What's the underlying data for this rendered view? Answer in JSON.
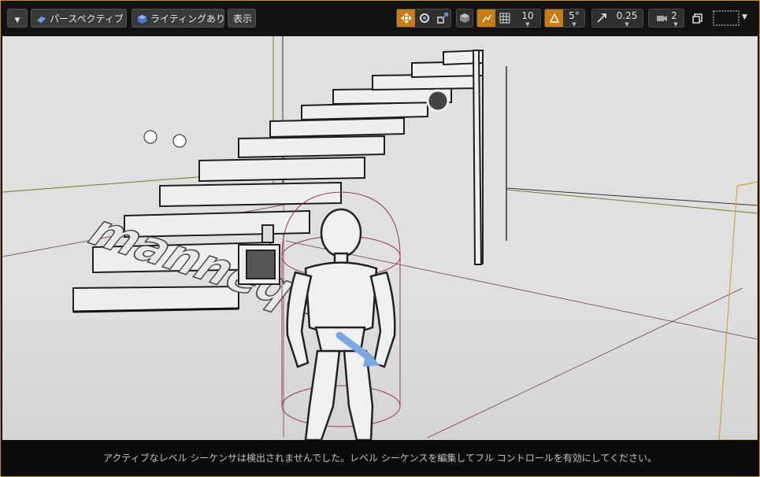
{
  "toolbar": {
    "menu_button": "menu-dropdown",
    "view_mode_label": "パースペクティブ",
    "lighting_label": "ライティングあり",
    "show_label": "表示",
    "grid_snap_value": "10",
    "rotation_snap_value": "5°",
    "scale_snap_value": "0.25",
    "camera_speed_value": "2"
  },
  "status_bar": {
    "message": "アクティブなレベル シーケンサは検出されませんでした。レベル シーケンスを編集してフル コントロールを有効にしてください。"
  },
  "scene": {
    "floor_text": "mannequin"
  },
  "colors": {
    "accent": "#c77c14",
    "frame_border": "#c8951c",
    "viewport_bg": "#dcdcdc",
    "toolbar_bg": "#121212"
  }
}
